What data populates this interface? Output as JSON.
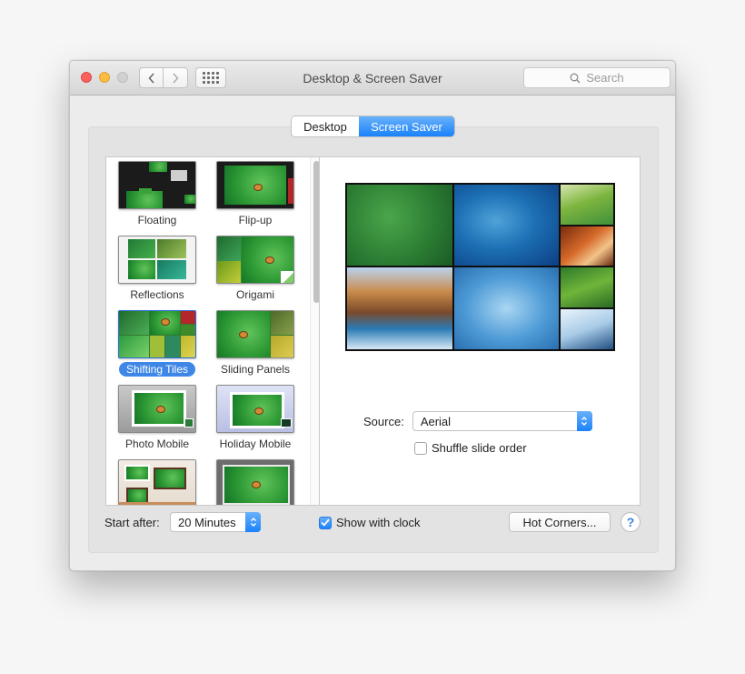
{
  "window": {
    "title": "Desktop & Screen Saver",
    "search_placeholder": "Search"
  },
  "tabs": [
    {
      "label": "Desktop",
      "selected": false
    },
    {
      "label": "Screen Saver",
      "selected": true
    }
  ],
  "screen_savers": [
    {
      "label": "Floating"
    },
    {
      "label": "Flip-up"
    },
    {
      "label": "Reflections"
    },
    {
      "label": "Origami"
    },
    {
      "label": "Shifting Tiles",
      "selected": true
    },
    {
      "label": "Sliding Panels"
    },
    {
      "label": "Photo Mobile"
    },
    {
      "label": "Holiday Mobile"
    },
    {
      "label": ""
    },
    {
      "label": ""
    }
  ],
  "options": {
    "source_label": "Source:",
    "source_value": "Aerial",
    "shuffle_label": "Shuffle slide order",
    "shuffle_checked": false
  },
  "footer": {
    "start_after_label": "Start after:",
    "start_after_value": "20 Minutes",
    "show_clock_label": "Show with clock",
    "show_clock_checked": true,
    "hot_corners_label": "Hot Corners...",
    "help_label": "?"
  },
  "colors": {
    "accent": "#1a82fb",
    "selection": "#3e87e6",
    "close": "#fc605c",
    "minimize": "#fdbc40"
  }
}
